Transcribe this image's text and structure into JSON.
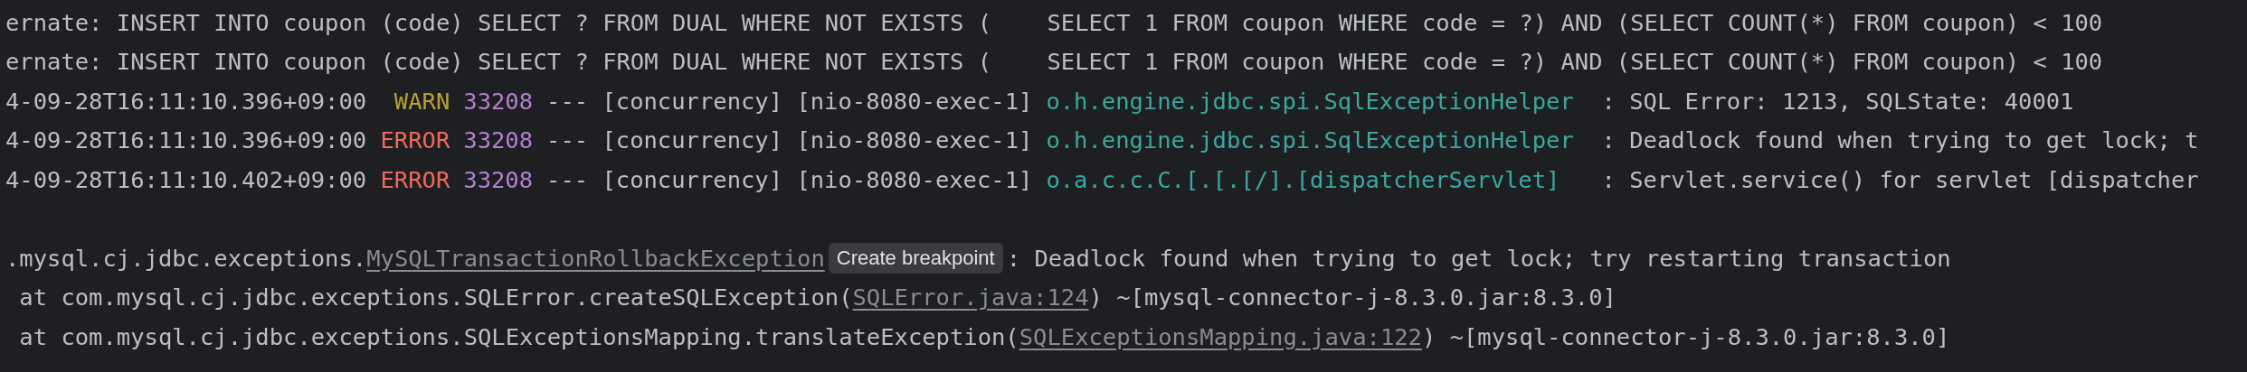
{
  "console": {
    "log_lines": [
      {
        "segments": [
          {
            "kind": "plain",
            "text": "ernate: INSERT INTO coupon (code) SELECT ? FROM DUAL WHERE NOT EXISTS (    SELECT 1 FROM coupon WHERE code = ?) AND (SELECT COUNT(*) FROM coupon) < 100"
          }
        ]
      },
      {
        "segments": [
          {
            "kind": "plain",
            "text": "ernate: INSERT INTO coupon (code) SELECT ? FROM DUAL WHERE NOT EXISTS (    SELECT 1 FROM coupon WHERE code = ?) AND (SELECT COUNT(*) FROM coupon) < 100"
          }
        ]
      },
      {
        "segments": [
          {
            "kind": "plain",
            "text": "4-09-28T16:11:10.396+09:00 "
          },
          {
            "kind": "warn",
            "text": " WARN"
          },
          {
            "kind": "pid",
            "text": "33208"
          },
          {
            "kind": "plain",
            "text": "--- [concurrency] [nio-8080-exec-1]"
          },
          {
            "kind": "logger",
            "text": "o.h.engine.jdbc.spi.SqlExceptionHelper"
          },
          {
            "kind": "plain",
            "text": "  : SQL Error: 1213, SQLState: 40001"
          }
        ]
      },
      {
        "segments": [
          {
            "kind": "plain",
            "text": "4-09-28T16:11:10.396+09:00 "
          },
          {
            "kind": "error",
            "text": "ERROR"
          },
          {
            "kind": "pid",
            "text": "33208"
          },
          {
            "kind": "plain",
            "text": "--- [concurrency] [nio-8080-exec-1]"
          },
          {
            "kind": "logger",
            "text": "o.h.engine.jdbc.spi.SqlExceptionHelper"
          },
          {
            "kind": "plain",
            "text": "  : Deadlock found when trying to get lock; t"
          }
        ]
      },
      {
        "segments": [
          {
            "kind": "plain",
            "text": "4-09-28T16:11:10.402+09:00 "
          },
          {
            "kind": "error",
            "text": "ERROR"
          },
          {
            "kind": "pid",
            "text": "33208"
          },
          {
            "kind": "plain",
            "text": "--- [concurrency] [nio-8080-exec-1]"
          },
          {
            "kind": "logger",
            "text": "o.a.c.c.C.[.[.[/].[dispatcherServlet]"
          },
          {
            "kind": "plain",
            "text": "   : Servlet.service() for servlet [dispatcher"
          }
        ]
      }
    ],
    "stack_trace": [
      {
        "segments": [
          {
            "kind": "plain",
            "text": ".mysql.cj.jdbc.exceptions."
          },
          {
            "kind": "link",
            "text": "MySQLTransactionRollbackException"
          },
          {
            "kind": "tooltip",
            "text": "Create breakpoint"
          },
          {
            "kind": "plain",
            "text": ": Deadlock found when trying to get lock; try restarting transaction"
          }
        ]
      },
      {
        "segments": [
          {
            "kind": "plain",
            "text": " at com.mysql.cj.jdbc.exceptions.SQLError.createSQLException("
          },
          {
            "kind": "link",
            "text": "SQLError.java:124"
          },
          {
            "kind": "plain",
            "text": ") ~[mysql-connector-j-8.3.0.jar:8.3.0]"
          }
        ]
      },
      {
        "segments": [
          {
            "kind": "plain",
            "text": " at com.mysql.cj.jdbc.exceptions.SQLExceptionsMapping.translateException("
          },
          {
            "kind": "link",
            "text": "SQLExceptionsMapping.java:122"
          },
          {
            "kind": "plain",
            "text": ") ~[mysql-connector-j-8.3.0.jar:8.3.0]"
          }
        ]
      }
    ]
  }
}
